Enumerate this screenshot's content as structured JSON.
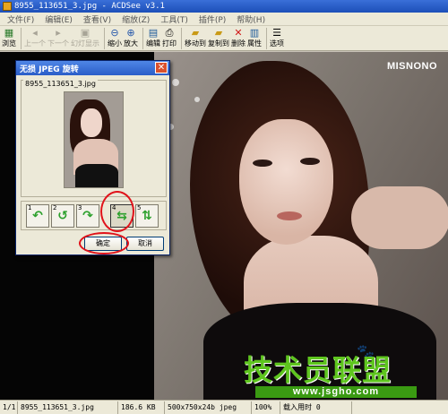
{
  "window": {
    "title": "8955_113651_3.jpg - ACDSee v3.1"
  },
  "menu": [
    "文件(F)",
    "编辑(E)",
    "查看(V)",
    "缩放(Z)",
    "工具(T)",
    "插件(P)",
    "帮助(H)"
  ],
  "toolbar": {
    "browse": "浏览",
    "prev": "上一个",
    "next": "下一个",
    "slideshow": "幻灯显示",
    "zoom_out": "缩小",
    "zoom_in": "放大",
    "edit": "编辑",
    "print": "打印",
    "move_to": "移动到",
    "copy_to": "复制到",
    "delete": "删除",
    "properties": "属性",
    "options": "选项"
  },
  "image": {
    "brand_text": "MISNONO",
    "watermark": "技术员联盟",
    "watermark_url": "www.jsgho.com"
  },
  "dialog": {
    "title": "无损 JPEG 旋转",
    "close": "✕",
    "filename": "8955_113651_3.jpg",
    "rotate_buttons": [
      {
        "num": "1",
        "arrow": "↶"
      },
      {
        "num": "2",
        "arrow": "↺"
      },
      {
        "num": "3",
        "arrow": "↷"
      },
      {
        "num": "4",
        "arrow": "⇆"
      },
      {
        "num": "5",
        "arrow": "⇅"
      }
    ],
    "selected_rotation": "4",
    "ok": "确定",
    "cancel": "取消"
  },
  "status": {
    "index": "1/1",
    "file": "8955_113651_3.jpg",
    "size": "186.6 KB",
    "dims": "500x750x24b jpeg",
    "zoom": "100%",
    "load_time": "载入用时 0"
  },
  "colors": {
    "accent": "#2a5dc8",
    "highlight_circle": "#e0121a",
    "watermark_green": "#5ec51e"
  }
}
